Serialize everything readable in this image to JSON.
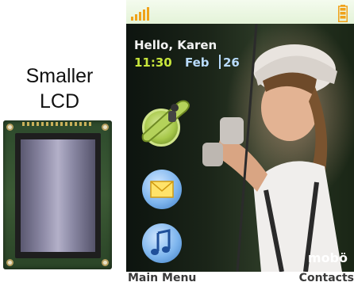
{
  "caption": {
    "line1": "Smaller",
    "line2": "LCD"
  },
  "phone": {
    "greeting": "Hello, Karen",
    "time": "11:30",
    "date_month": "Feb",
    "date_day": "26",
    "brand": "mobö",
    "status": {
      "signal": "signal-icon",
      "battery": "battery-icon"
    },
    "shortcuts": [
      {
        "icon": "snowboard-icon"
      },
      {
        "icon": "envelope-icon"
      },
      {
        "icon": "music-note-icon"
      }
    ]
  },
  "softkeys": {
    "left": "Main Menu",
    "right": "Contacts"
  },
  "colors": {
    "time": "#c8e63c",
    "date": "#b9dcff",
    "status_bar": "#e8f5dc",
    "accent_orange": "#f0a21a"
  }
}
